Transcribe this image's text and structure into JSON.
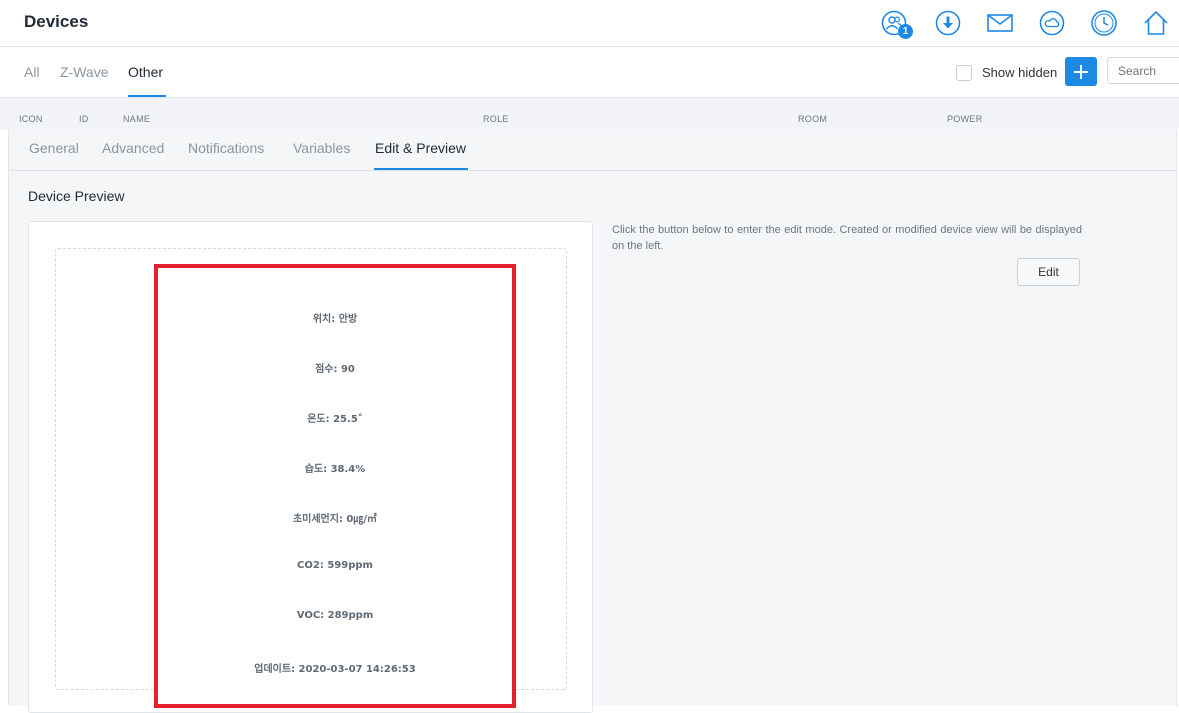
{
  "header": {
    "title": "Devices",
    "user_badge": "1",
    "icons": [
      "users-icon",
      "download-icon",
      "mail-icon",
      "cloud-icon",
      "clock-icon",
      "home-icon"
    ]
  },
  "filter_tabs": [
    {
      "label": "All",
      "active": false
    },
    {
      "label": "Z-Wave",
      "active": false
    },
    {
      "label": "Other",
      "active": true
    }
  ],
  "toolbar": {
    "show_hidden_label": "Show hidden",
    "show_hidden_checked": false,
    "search_placeholder": "Search"
  },
  "columns": [
    "ICON",
    "ID",
    "NAME",
    "ROLE",
    "ROOM",
    "POWER"
  ],
  "device_tabs": [
    {
      "label": "General"
    },
    {
      "label": "Advanced"
    },
    {
      "label": "Notifications"
    },
    {
      "label": "Variables"
    },
    {
      "label": "Edit & Preview",
      "active": true
    }
  ],
  "preview": {
    "heading": "Device Preview",
    "lines": [
      "위치: 안방",
      "점수: 90",
      "온도: 25.5˚",
      "습도: 38.4%",
      "초미세먼지: 0㎍/㎥",
      "CO2: 599ppm",
      "VOC: 289ppm",
      "업데이트: 2020-03-07 14:26:53"
    ]
  },
  "edit_panel": {
    "help_text": "Click the button below to enter the edit mode. Created or modified device view will be displayed on the left.",
    "edit_button": "Edit"
  },
  "colors": {
    "accent": "#1e88e5",
    "highlight_border": "#e4212b"
  }
}
